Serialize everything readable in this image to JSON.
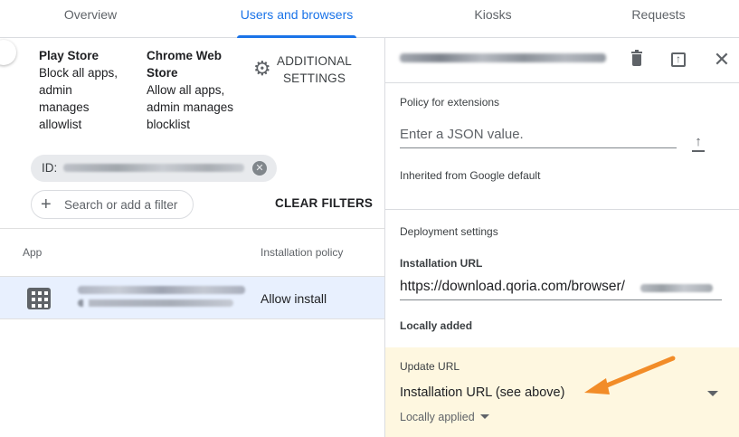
{
  "tabs": [
    {
      "label": "Overview",
      "active": false
    },
    {
      "label": "Users and browsers",
      "active": true
    },
    {
      "label": "Kiosks",
      "active": false
    },
    {
      "label": "Requests",
      "active": false
    }
  ],
  "summary": {
    "play_store": {
      "heading": "Play Store",
      "lines": [
        "Block all apps,",
        "admin",
        "manages",
        "allowlist"
      ]
    },
    "chrome_web_store": {
      "heading_lines": [
        "Chrome Web",
        "Store"
      ],
      "lines": [
        "Allow all apps,",
        "admin manages",
        "blocklist"
      ]
    },
    "additional_settings": {
      "lines": [
        "ADDITIONAL",
        "SETTINGS"
      ],
      "icon": "gear-icon"
    }
  },
  "filter": {
    "chip_prefix": "ID:",
    "search_placeholder": "Search or add a filter",
    "clear_label": "CLEAR FILTERS"
  },
  "apps_table": {
    "columns": [
      "App",
      "Installation policy"
    ],
    "rows": [
      {
        "icon": "app-grid-icon",
        "policy": "Allow install",
        "selected": true
      }
    ]
  },
  "details": {
    "policy_extensions_label": "Policy for extensions",
    "json_placeholder": "Enter a JSON value.",
    "inherited_label": "Inherited from Google default",
    "deployment_label": "Deployment settings",
    "installation_url_label": "Installation URL",
    "installation_url_value": "https://download.qoria.com/browser/",
    "locally_added": "Locally added",
    "update_url_label": "Update URL",
    "update_url_value": "Installation URL (see above)",
    "locally_applied": "Locally applied"
  },
  "colors": {
    "accent": "#1a73e8",
    "selected_row": "#e8f0fe",
    "highlight_box": "#fef7e0",
    "arrow": "#f28c28"
  }
}
